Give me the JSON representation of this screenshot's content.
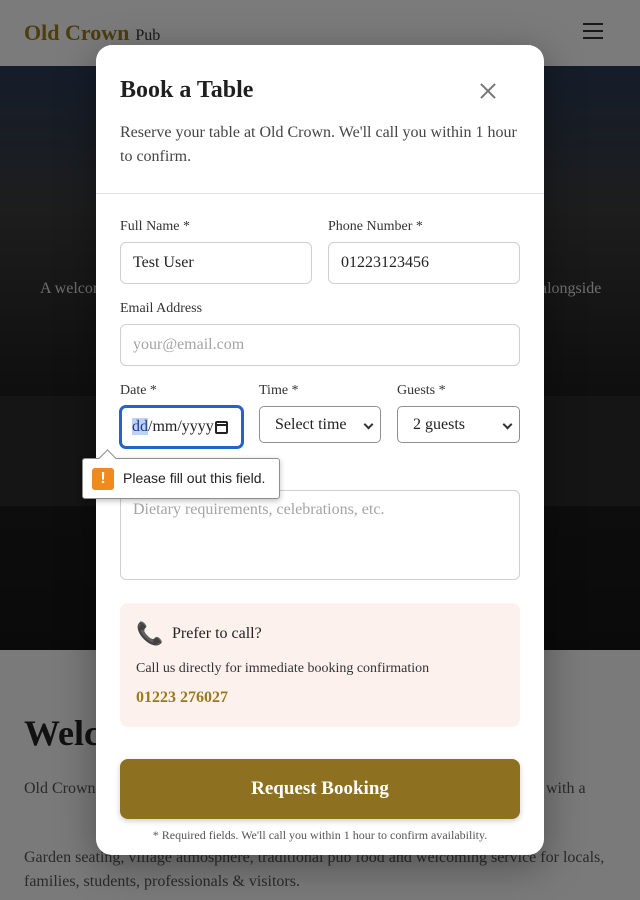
{
  "background": {
    "logo": "Old Crown",
    "logo_sub": "Pub",
    "hero_left": "A welcoming",
    "hero_right": "alongside",
    "heading": "Welc",
    "p1_left": "Old Crown",
    "p1_right": "with a",
    "p2": "Garden seating, village atmosphere, traditional pub food and welcoming service for locals, families, students, professionals & visitors."
  },
  "modal": {
    "title": "Book a Table",
    "description": "Reserve your table at Old Crown. We'll call you within 1 hour to confirm.",
    "fields": {
      "full_name": {
        "label": "Full Name *",
        "value": "Test User"
      },
      "phone": {
        "label": "Phone Number *",
        "value": "01223123456"
      },
      "email": {
        "label": "Email Address",
        "placeholder": "your@email.com"
      },
      "date": {
        "label": "Date *",
        "segment_selected": "dd",
        "rest": "/mm/yyyy"
      },
      "time": {
        "label": "Time *",
        "value": "Select time"
      },
      "guests": {
        "label": "Guests *",
        "value": "2 guests"
      },
      "notes": {
        "placeholder": "Dietary requirements, celebrations, etc."
      }
    },
    "validation_tooltip": "Please fill out this field.",
    "call_box": {
      "title": "Prefer to call?",
      "subtitle": "Call us directly for immediate booking confirmation",
      "number": "01223 276027"
    },
    "submit_label": "Request Booking",
    "footnote": "* Required fields. We'll call you within 1 hour to confirm availability."
  },
  "colors": {
    "accent": "#8d7020",
    "call_box_bg": "#fdf1ee",
    "focus": "#2563c9"
  }
}
